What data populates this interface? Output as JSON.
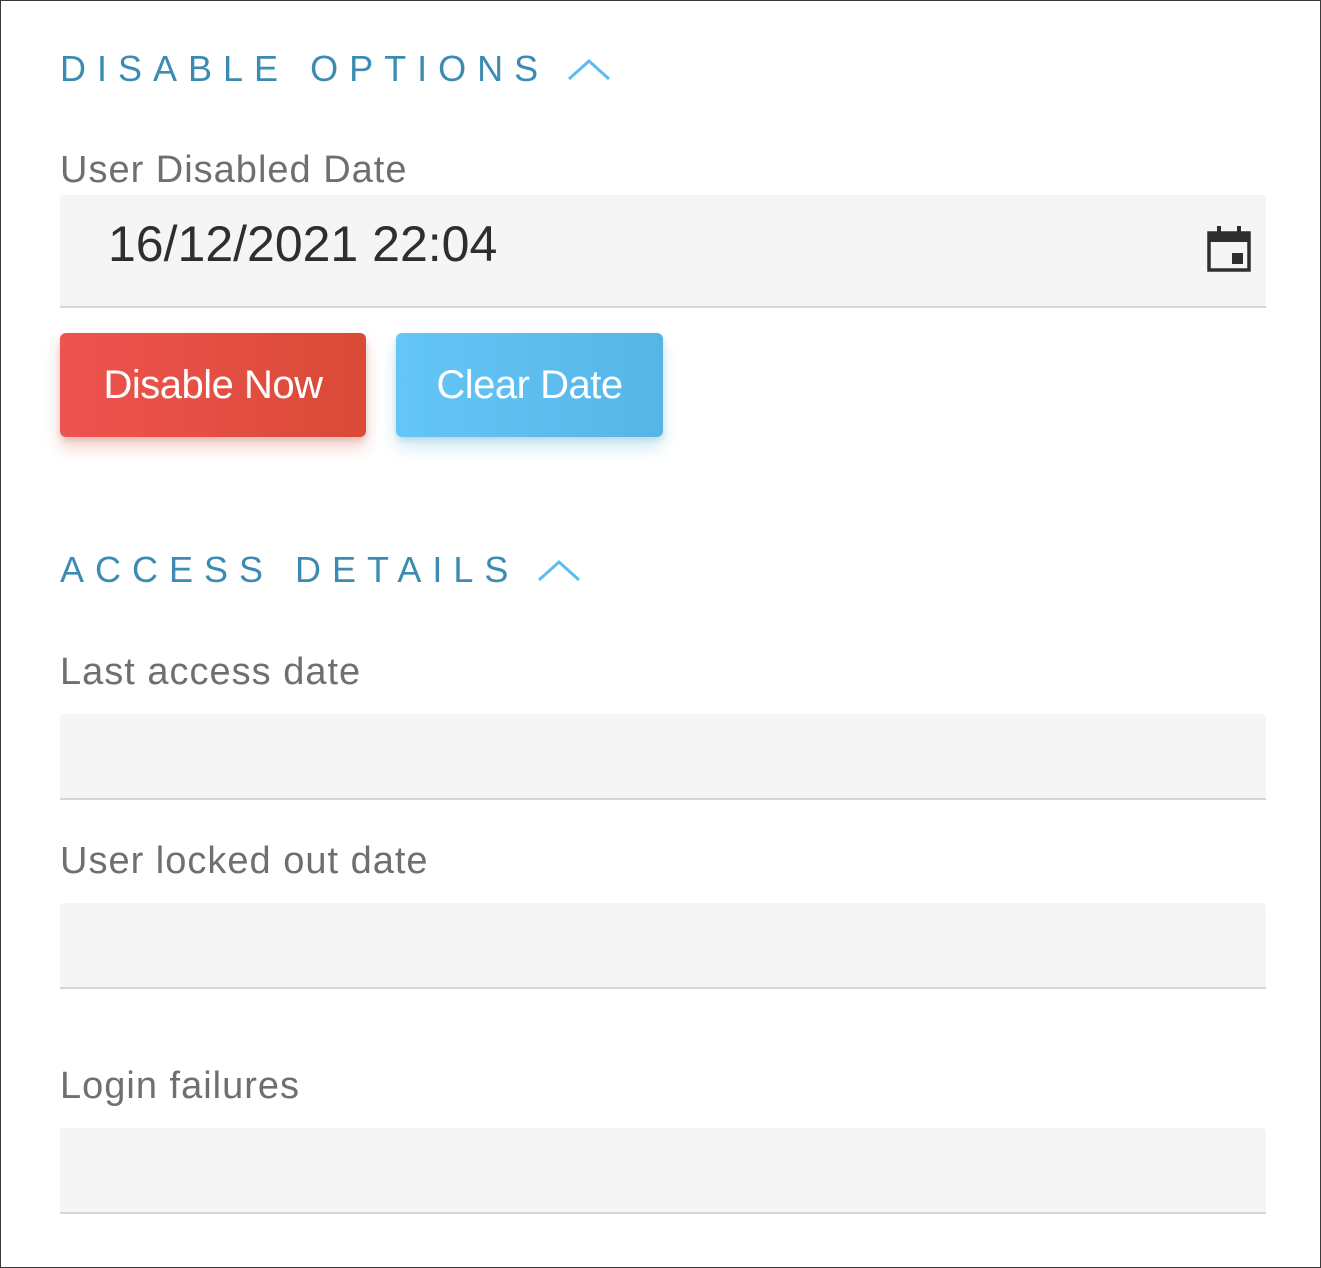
{
  "disable_options": {
    "title": "Disable Options",
    "user_disabled_date": {
      "label": "User Disabled Date",
      "value": "16/12/2021 22:04"
    },
    "disable_now_label": "Disable Now",
    "clear_date_label": "Clear Date"
  },
  "access_details": {
    "title": "Access Details",
    "last_access_date": {
      "label": "Last access date",
      "value": ""
    },
    "user_locked_out_date": {
      "label": "User locked out date",
      "value": ""
    },
    "login_failures": {
      "label": "Login failures",
      "value": ""
    }
  },
  "icons": {
    "collapse": "chevron-up-icon",
    "date_picker": "calendar-icon"
  },
  "colors": {
    "section_title": "#3b8bb3",
    "chevron": "#5bbef0",
    "disable_button": "#e64a3c",
    "clear_button": "#5ec0f2"
  }
}
